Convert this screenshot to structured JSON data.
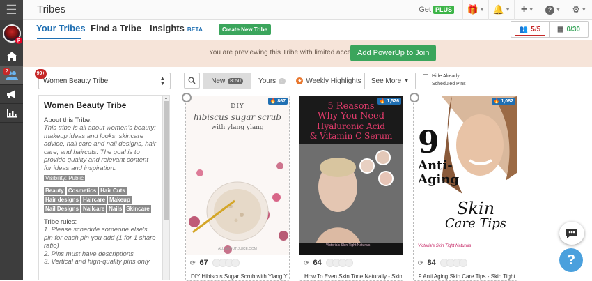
{
  "app": {
    "title": "Tribes"
  },
  "topbar": {
    "get_label": "Get",
    "plus_badge": "PLUS"
  },
  "tabs": [
    {
      "label": "Your Tribes"
    },
    {
      "label": "Find a Tribe"
    },
    {
      "label": "Insights",
      "badge": "BETA"
    }
  ],
  "create_button": "Create New Tribe",
  "stats": {
    "members": "5/5",
    "submissions": "0/30"
  },
  "preview": {
    "text": "You are previewing this Tribe with limited access",
    "button": "Add PowerUp to Join"
  },
  "sidebar": {
    "badge_count": "2"
  },
  "tribe_select": {
    "value": "Women Beauty Tribe",
    "badge": "99+"
  },
  "filters": {
    "new_label": "New",
    "new_count": "8050",
    "yours_label": "Yours",
    "yours_count": "0",
    "highlights_label": "Weekly Highlights",
    "more_label": "See More",
    "hide_label_1": "Hide Already",
    "hide_label_2": "Scheduled Pins"
  },
  "info": {
    "title": "Women Beauty Tribe",
    "about_label": "About this Tribe:",
    "about_text": "This tribe is all about women's beauty: makeup ideas and looks, skincare advice, nail care and nail designs, hair care, and haircuts. The goal is to provide quality and relevant content for ideas and inspiration.",
    "visibility": "Visibility: Public",
    "tags": [
      "Beauty",
      "Cosmetics",
      "Hair Cuts",
      "Hair designs",
      "Haircare",
      "Makeup",
      "Nail Designs",
      "Nailcare",
      "Nails",
      "Skincare"
    ],
    "rules_label": "Tribe rules:",
    "rules": [
      "1. Please schedule someone else's pin for each pin you add (1 for 1 share ratio)",
      "2. Pins must have descriptions",
      "3. Vertical and high-quality pins only"
    ]
  },
  "pins": [
    {
      "count": "867",
      "repins": "67",
      "title": "DIY Hibiscus Sugar Scrub with Ylang Ylang",
      "img_line1": "DIY",
      "img_line2": "hibiscus sugar scrub",
      "img_line3": "with ylang ylang",
      "img_url": "ALL ABOUT JUICE.COM"
    },
    {
      "count": "1,526",
      "repins": "64",
      "title": "How To Even Skin Tone Naturally - Skin",
      "img_line1": "5 Reasons",
      "img_line2": "Why You Need",
      "img_line3": "Hyaluronic Acid",
      "img_line4": "& Vitamin C Serum",
      "img_brand": "Victoria's Skin Tight Naturals"
    },
    {
      "count": "1,082",
      "repins": "84",
      "title": "9 Anti Aging Skin Care Tips - Skin Tight",
      "img_line1": "9",
      "img_line2": "Anti-",
      "img_line3": "Aging",
      "img_line4": "Skin",
      "img_line5": "Care Tips",
      "img_brand": "Victoria's Skin Tight Naturals"
    }
  ]
}
